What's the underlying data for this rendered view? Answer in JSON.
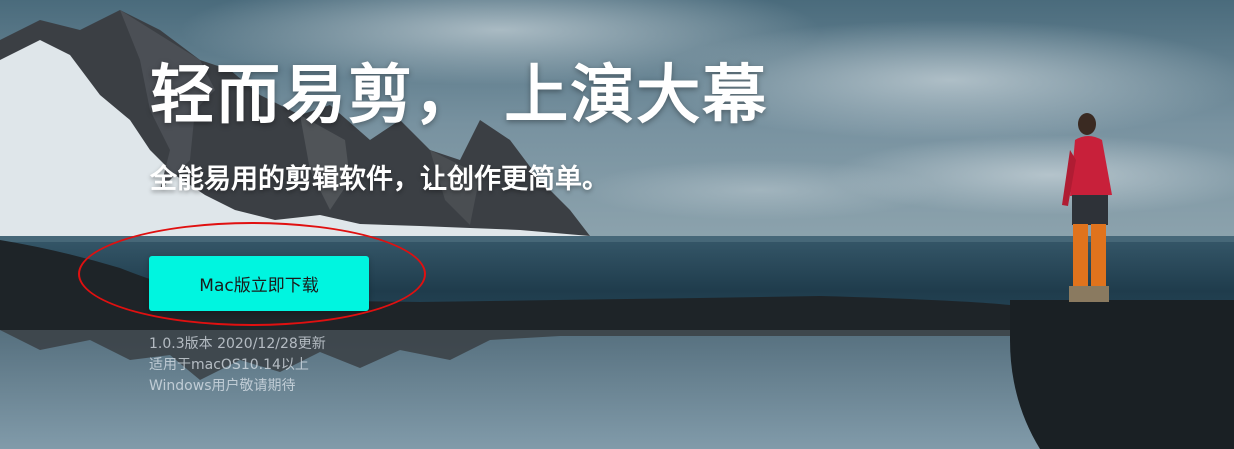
{
  "hero": {
    "title": "轻而易剪， 上演大幕",
    "subtitle": "全能易用的剪辑软件，让创作更简单。",
    "download_button": "Mac版立即下载",
    "version_info": "1.0.3版本 2020/12/28更新",
    "requirement": "适用于macOS10.14以上",
    "windows_note": "Windows用户敬请期待"
  },
  "colors": {
    "button": "#00f5e0",
    "annotation": "#e01010",
    "sky": "#6c8896",
    "sea": "#234152"
  }
}
